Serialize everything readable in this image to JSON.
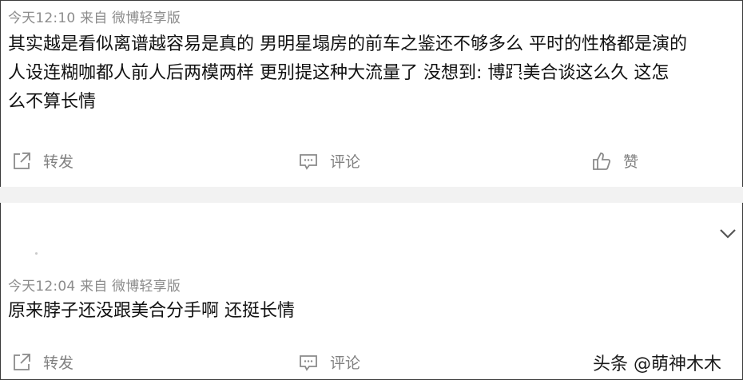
{
  "comment1": {
    "meta": "今天12:10 来自 微博轻享版",
    "lines": [
      "其实越是看似离谱越容易是真的 男明星塌房的前车之鉴还不够多么 平时的性格都是演的",
      "人设连糊咖都人前人后两模两样 更别提这种大流量了 没想到: 博跟美合谈这么久 这怎",
      "么不算长情"
    ]
  },
  "comment2": {
    "meta": "今天12:04 来自 微博轻享版",
    "lines": [
      "原来脖子还没跟美合分手啊 还挺长情"
    ]
  },
  "actions": {
    "repost": "转发",
    "comment": "评论",
    "like": "赞"
  },
  "watermark": "头条 @萌神木木",
  "icons": {
    "repost": "share-icon",
    "comment": "comment-icon",
    "like": "thumbs-up-icon",
    "expand": "chevron-down-icon"
  }
}
